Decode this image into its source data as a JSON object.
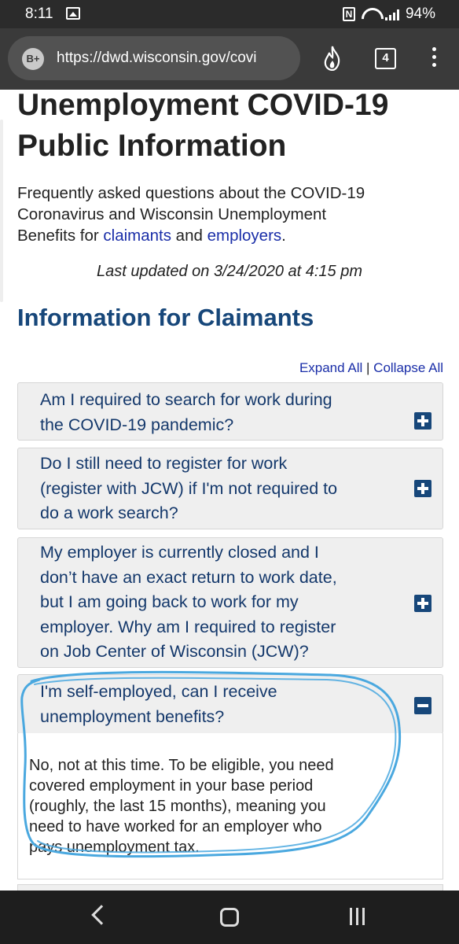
{
  "status_bar": {
    "time": "8:11",
    "battery": "94%"
  },
  "browser": {
    "grade": "B+",
    "url": "https://dwd.wisconsin.gov/covi",
    "tab_count": "4"
  },
  "page": {
    "title_line1": "Unemployment COVID-19",
    "title_line2": "Public Information",
    "intro_line1": "Frequently asked questions about the COVID-19",
    "intro_line2": "Coronavirus and Wisconsin Unemployment",
    "intro_prefix": "Benefits for ",
    "link_claimants": "claimants",
    "intro_and": " and ",
    "link_employers": "employers",
    "intro_end": ".",
    "last_updated": "Last updated on 3/24/2020 at 4:15 pm",
    "section_title": "Information for Claimants",
    "expand_all": "Expand All",
    "separator": "|",
    "collapse_all": "Collapse All"
  },
  "faqs": [
    {
      "question_lines": [
        "Am I required to search for work during",
        "the COVID-19 pandemic?"
      ],
      "expanded": false
    },
    {
      "question_lines": [
        "Do I still need to register for work",
        "(register with JCW) if I'm not required to",
        "do a work search?"
      ],
      "expanded": false
    },
    {
      "question_lines": [
        "My employer is currently closed and I",
        "don’t have an exact return to work date,",
        "but I am going back to work for my",
        "employer. Why am I required to register",
        "on Job Center of Wisconsin (JCW)?"
      ],
      "expanded": false
    },
    {
      "question_lines": [
        "I'm self-employed, can I receive",
        "unemployment benefits?"
      ],
      "expanded": true,
      "answer_lines": [
        "No, not at this time. To be eligible, you need",
        "covered employment in your base period",
        "(roughly, the last 15 months), meaning you",
        "need to have worked for an employer who",
        "pays unemployment tax."
      ]
    }
  ],
  "colors": {
    "heading_blue": "#17477a",
    "link_blue": "#1a2ea8",
    "annotation_circle": "#4aa8df"
  }
}
